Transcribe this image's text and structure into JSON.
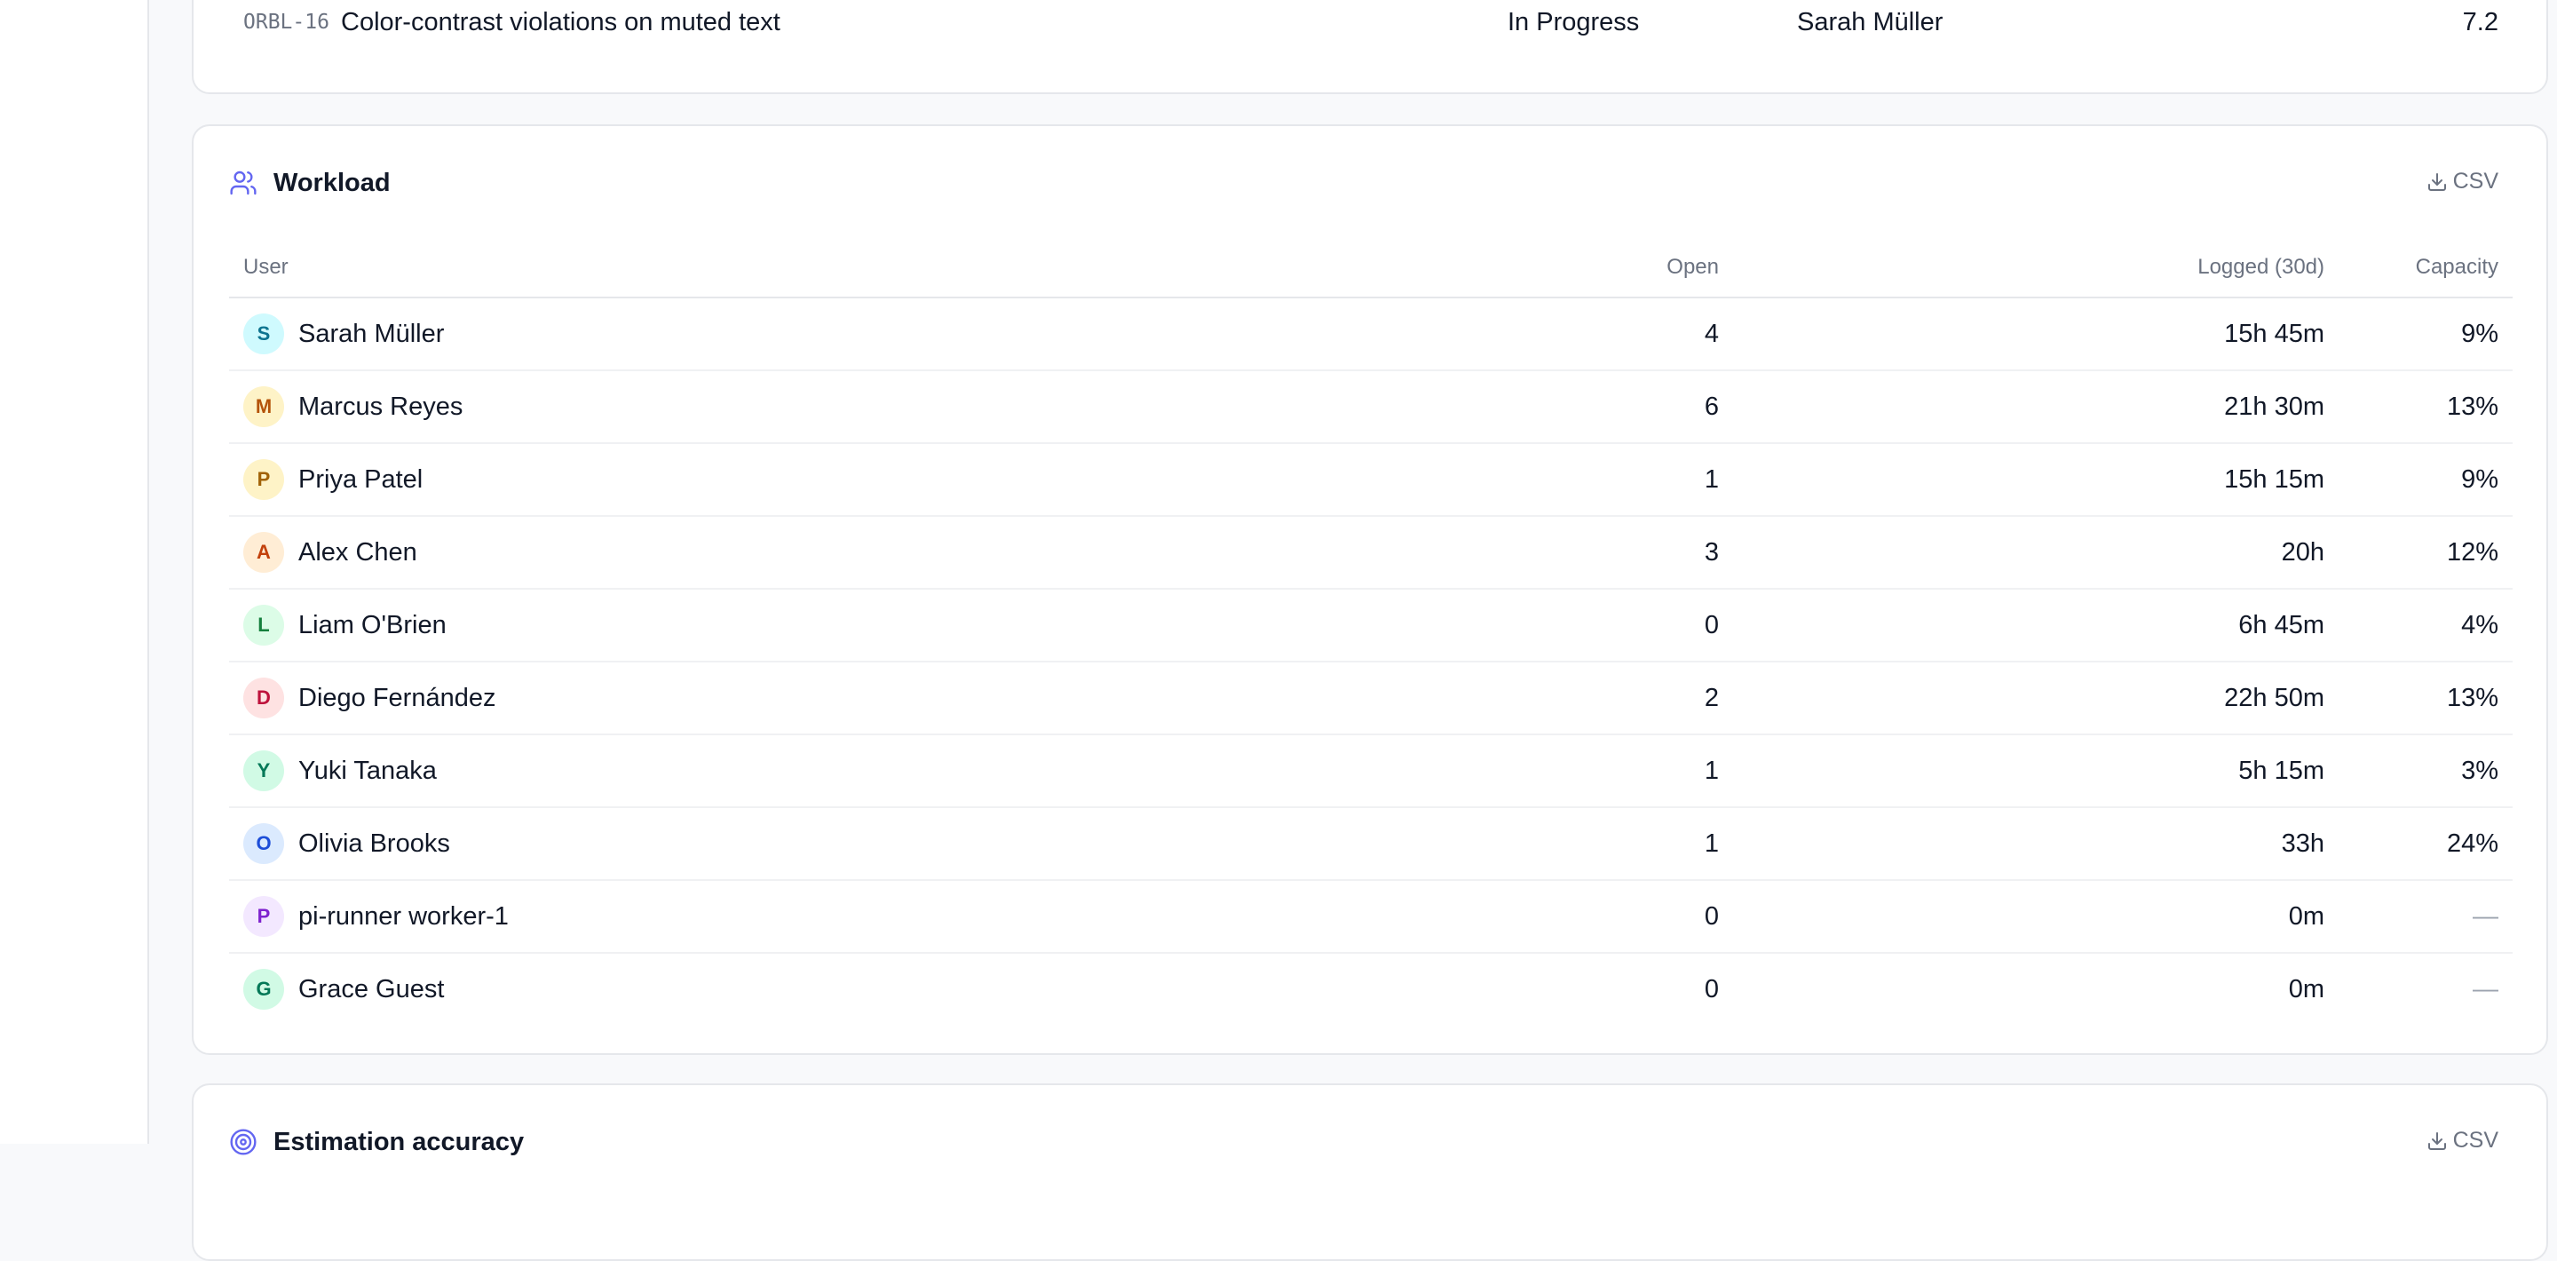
{
  "top_issue": {
    "key": "ORBL-16",
    "title": "Color-contrast violations on muted text",
    "status": "In Progress",
    "assignee": "Sarah Müller",
    "score": "7.2"
  },
  "workload": {
    "title": "Workload",
    "csv_label": "CSV",
    "columns": {
      "user": "User",
      "open": "Open",
      "logged": "Logged (30d)",
      "capacity": "Capacity"
    },
    "rows": [
      {
        "initial": "S",
        "name": "Sarah Müller",
        "open": "4",
        "logged": "15h 45m",
        "capacity": "9%",
        "avatar_bg": "#cffafe",
        "avatar_fg": "#0e7490"
      },
      {
        "initial": "M",
        "name": "Marcus Reyes",
        "open": "6",
        "logged": "21h 30m",
        "capacity": "13%",
        "avatar_bg": "#fef3c7",
        "avatar_fg": "#b45309"
      },
      {
        "initial": "P",
        "name": "Priya Patel",
        "open": "1",
        "logged": "15h 15m",
        "capacity": "9%",
        "avatar_bg": "#fef3c7",
        "avatar_fg": "#a16207"
      },
      {
        "initial": "A",
        "name": "Alex Chen",
        "open": "3",
        "logged": "20h",
        "capacity": "12%",
        "avatar_bg": "#ffedd5",
        "avatar_fg": "#c2410c"
      },
      {
        "initial": "L",
        "name": "Liam O'Brien",
        "open": "0",
        "logged": "6h 45m",
        "capacity": "4%",
        "avatar_bg": "#dcfce7",
        "avatar_fg": "#15803d"
      },
      {
        "initial": "D",
        "name": "Diego Fernández",
        "open": "2",
        "logged": "22h 50m",
        "capacity": "13%",
        "avatar_bg": "#fee2e2",
        "avatar_fg": "#be123c"
      },
      {
        "initial": "Y",
        "name": "Yuki Tanaka",
        "open": "1",
        "logged": "5h 15m",
        "capacity": "3%",
        "avatar_bg": "#d1fae5",
        "avatar_fg": "#047857"
      },
      {
        "initial": "O",
        "name": "Olivia Brooks",
        "open": "1",
        "logged": "33h",
        "capacity": "24%",
        "avatar_bg": "#dbeafe",
        "avatar_fg": "#1d4ed8"
      },
      {
        "initial": "P",
        "name": "pi-runner worker-1",
        "open": "0",
        "logged": "0m",
        "capacity": "—",
        "avatar_bg": "#f3e8ff",
        "avatar_fg": "#7e22ce"
      },
      {
        "initial": "G",
        "name": "Grace Guest",
        "open": "0",
        "logged": "0m",
        "capacity": "—",
        "avatar_bg": "#d1fae5",
        "avatar_fg": "#047857"
      }
    ]
  },
  "estimation": {
    "title": "Estimation accuracy",
    "csv_label": "CSV"
  },
  "colors": {
    "accent": "#6366f1",
    "border": "#e5e7eb",
    "muted_text": "#6b7280"
  },
  "icons": {
    "workload": "users-icon",
    "estimation": "target-icon",
    "csv": "download-icon"
  }
}
